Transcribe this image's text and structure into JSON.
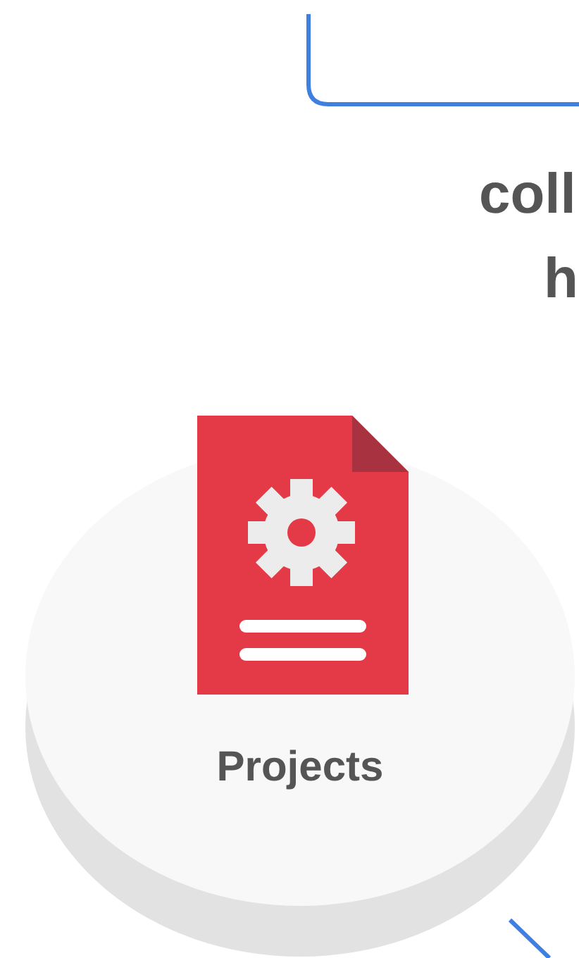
{
  "heading_lines": [
    "coll",
    "h"
  ],
  "node": {
    "label": "Projects"
  }
}
